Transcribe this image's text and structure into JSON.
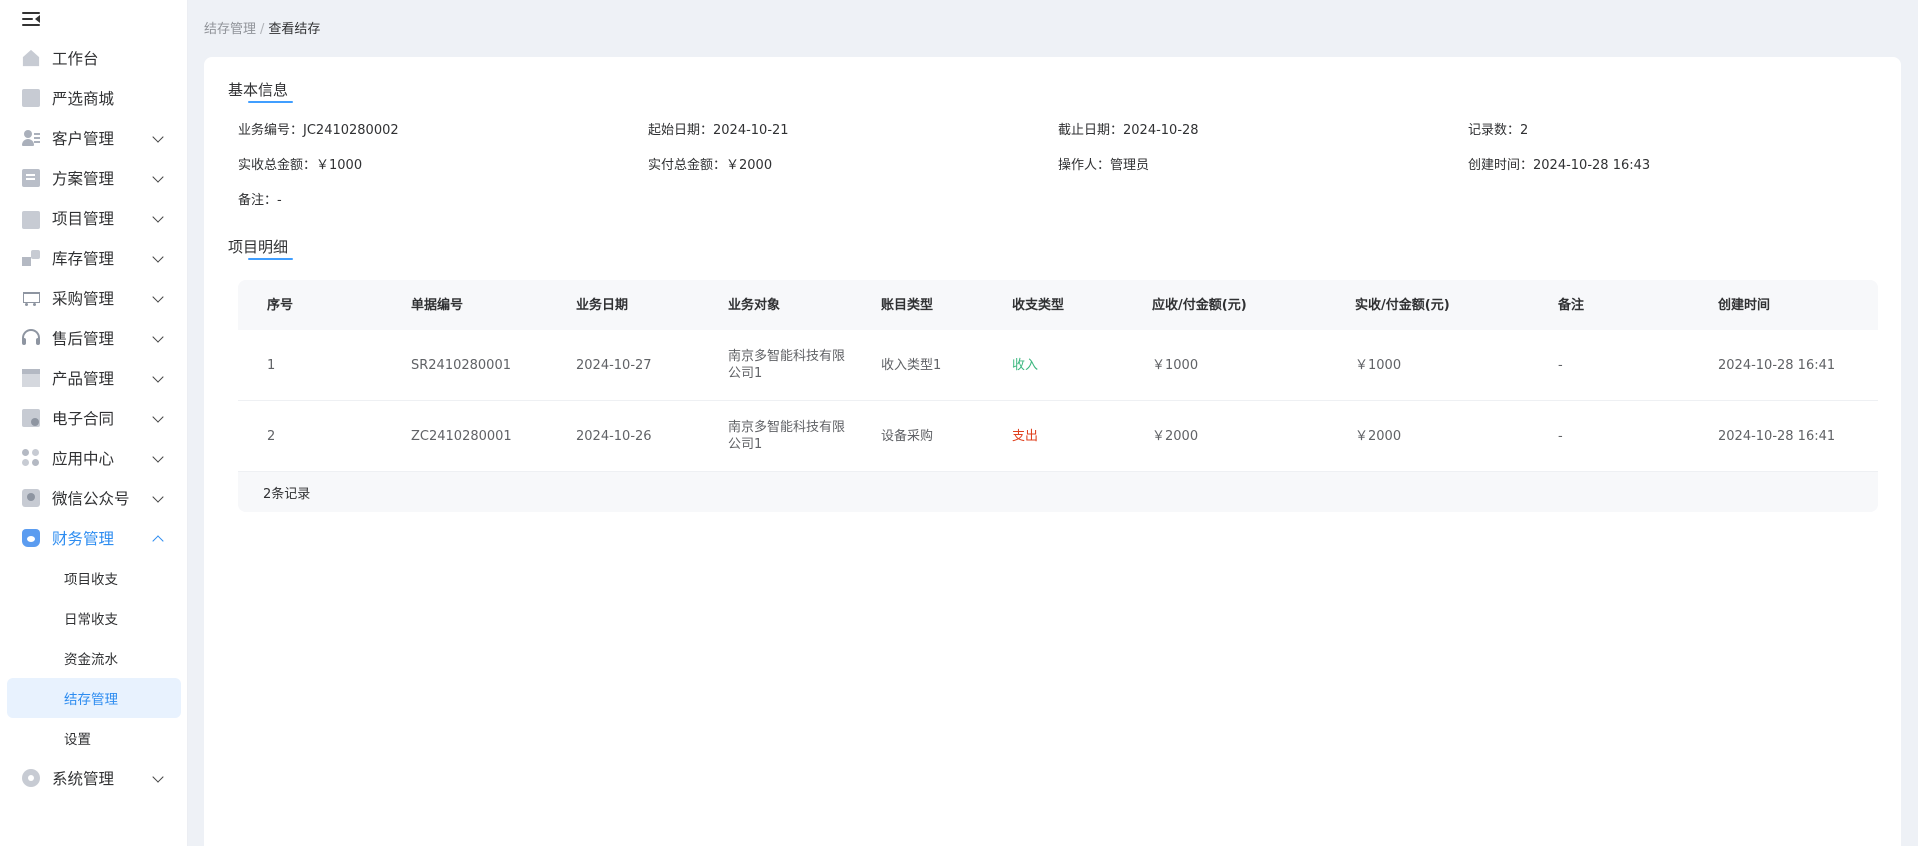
{
  "sidebar": {
    "items": [
      {
        "label": "工作台",
        "icon": "home-icon"
      },
      {
        "label": "严选商城",
        "icon": "shop-icon"
      },
      {
        "label": "客户管理",
        "icon": "customer-icon"
      },
      {
        "label": "方案管理",
        "icon": "plan-icon"
      },
      {
        "label": "项目管理",
        "icon": "folder-icon"
      },
      {
        "label": "库存管理",
        "icon": "inventory-icon"
      },
      {
        "label": "采购管理",
        "icon": "cart-icon"
      },
      {
        "label": "售后管理",
        "icon": "headset-icon"
      },
      {
        "label": "产品管理",
        "icon": "product-icon"
      },
      {
        "label": "电子合同",
        "icon": "contract-icon"
      },
      {
        "label": "应用中心",
        "icon": "apps-icon"
      },
      {
        "label": "微信公众号",
        "icon": "wechat-icon"
      },
      {
        "label": "财务管理",
        "icon": "finance-icon"
      },
      {
        "label": "系统管理",
        "icon": "settings-icon"
      }
    ],
    "finance_sub": [
      "项目收支",
      "日常收支",
      "资金流水",
      "结存管理",
      "设置"
    ]
  },
  "breadcrumb": {
    "parent": "结存管理",
    "separator": "/",
    "current": "查看结存"
  },
  "basic_info": {
    "title": "基本信息",
    "fields": [
      {
        "label": "业务编号：",
        "value": "JC2410280002"
      },
      {
        "label": "起始日期：",
        "value": "2024-10-21"
      },
      {
        "label": "截止日期：",
        "value": "2024-10-28"
      },
      {
        "label": "记录数：",
        "value": "2"
      },
      {
        "label": "实收总金额：",
        "value": "￥1000"
      },
      {
        "label": "实付总金额：",
        "value": "￥2000"
      },
      {
        "label": "操作人：",
        "value": "管理员"
      },
      {
        "label": "创建时间：",
        "value": "2024-10-28 16:43"
      },
      {
        "label": "备注：",
        "value": "-"
      }
    ]
  },
  "detail": {
    "title": "项目明细",
    "columns": [
      "序号",
      "单据编号",
      "业务日期",
      "业务对象",
      "账目类型",
      "收支类型",
      "应收/付金额(元)",
      "实收/付金额(元)",
      "备注",
      "创建时间"
    ],
    "rows": [
      [
        "1",
        "SR2410280001",
        "2024-10-27",
        "南京多智能科技有限公司1",
        "收入类型1",
        "收入",
        "￥1000",
        "￥1000",
        "-",
        "2024-10-28 16:41"
      ],
      [
        "2",
        "ZC2410280001",
        "2024-10-26",
        "南京多智能科技有限公司1",
        "设备采购",
        "支出",
        "￥2000",
        "￥2000",
        "-",
        "2024-10-28 16:41"
      ]
    ],
    "footer": "2条记录"
  },
  "colors": {
    "accent": "#2d8cf0",
    "income": "#3cb77f",
    "expense": "#e0401e"
  }
}
